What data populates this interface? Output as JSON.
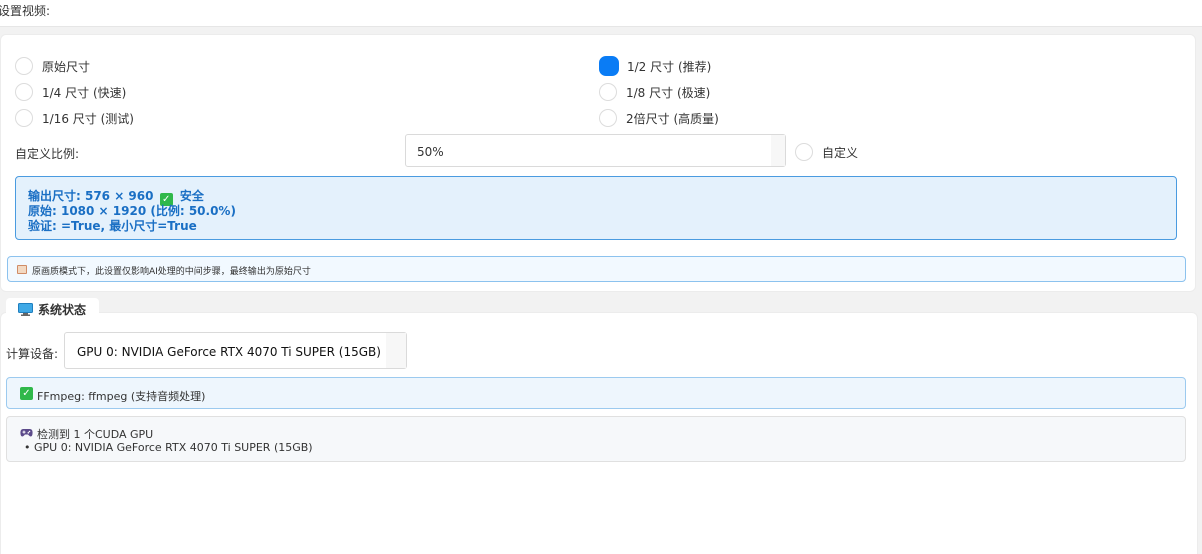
{
  "top_bar": {
    "label": "设置视频:"
  },
  "resolution": {
    "options": [
      {
        "label": "原始尺寸",
        "checked": false
      },
      {
        "label": "1/2 尺寸 (推荐)",
        "checked": true
      },
      {
        "label": "1/4 尺寸 (快速)",
        "checked": false
      },
      {
        "label": "1/8 尺寸 (极速)",
        "checked": false
      },
      {
        "label": "1/16 尺寸 (测试)",
        "checked": false
      },
      {
        "label": "2倍尺寸 (高质量)",
        "checked": false
      }
    ],
    "custom_ratio_label": "自定义比例:",
    "custom_ratio_value": "50%",
    "custom_option_label": "自定义"
  },
  "info": {
    "output_prefix": "输出尺寸: 576 × 960",
    "output_status": "安全",
    "original": "原始: 1080 × 1920 (比例: 50.0%)",
    "validation": "验证: =True, 最小尺寸=True"
  },
  "note": {
    "icon": "pencil-icon",
    "text": "原画质模式下，此设置仅影响AI处理的中间步骤，最终输出为原始尺寸"
  },
  "system_status": {
    "tab_icon": "monitor-icon",
    "tab_label": "系统状态",
    "device_label": "计算设备:",
    "device_value": "GPU 0: NVIDIA GeForce RTX 4070 Ti SUPER (15GB)",
    "ffmpeg_text": "FFmpeg: ffmpeg (支持音频处理)",
    "gpu_icon": "gamepad-icon",
    "gpu_detect": "检测到 1 个CUDA GPU",
    "gpu_item": "• GPU 0: NVIDIA GeForce RTX 4070 Ti SUPER (15GB)"
  },
  "colors": {
    "accent": "#0a7cf5",
    "info_text": "#1a6fc4",
    "success": "#2fb84a"
  }
}
